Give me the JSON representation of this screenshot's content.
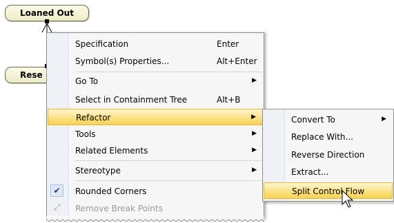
{
  "diagram": {
    "nodes": [
      "Loaned Out",
      "Rese"
    ]
  },
  "context_menu": {
    "items": [
      {
        "label": "Specification",
        "shortcut": "Enter"
      },
      {
        "label": "Symbol(s) Properties...",
        "shortcut": "Alt+Enter"
      },
      {
        "label": "Go To",
        "shortcut": ""
      },
      {
        "label": "Select in Containment Tree",
        "shortcut": "Alt+B"
      },
      {
        "label": "Refactor",
        "shortcut": ""
      },
      {
        "label": "Tools",
        "shortcut": ""
      },
      {
        "label": "Related Elements",
        "shortcut": ""
      },
      {
        "label": "Stereotype",
        "shortcut": ""
      },
      {
        "label": "Rounded Corners",
        "shortcut": ""
      },
      {
        "label": "Remove Break Points",
        "shortcut": ""
      }
    ],
    "rounded_corners_checked": true,
    "highlight_color": "#f9d24f"
  },
  "refactor_submenu": {
    "items": [
      {
        "label": "Convert To"
      },
      {
        "label": "Replace With..."
      },
      {
        "label": "Reverse Direction"
      },
      {
        "label": "Extract..."
      },
      {
        "label": "Split Control Flow"
      }
    ]
  },
  "icons": {
    "submenu_arrow": "submenu-arrow-icon",
    "check": "check-icon",
    "remove_break_points": "break-point-line-icon",
    "cursor": "mouse-pointer-icon"
  }
}
